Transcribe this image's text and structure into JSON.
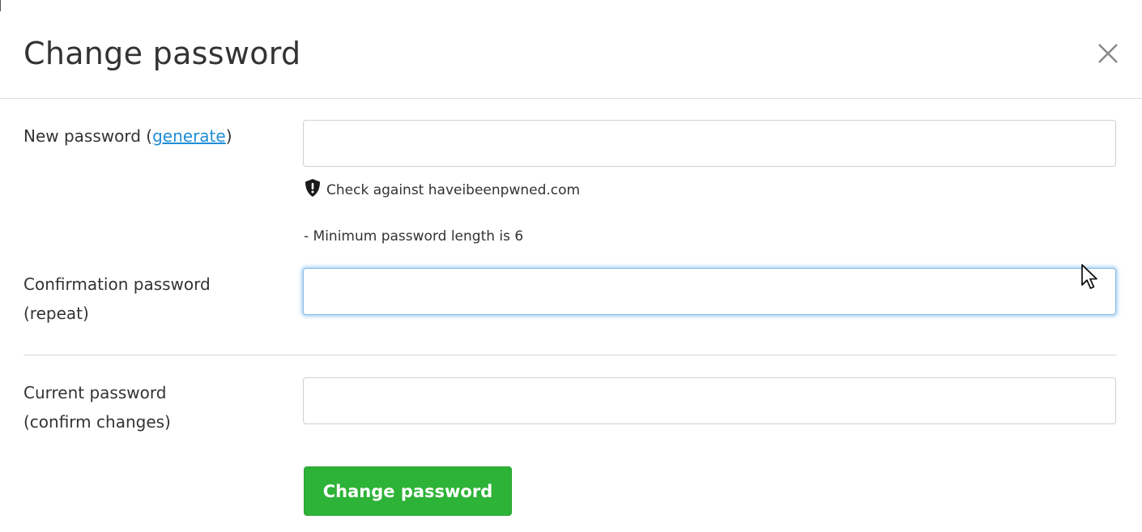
{
  "dialog": {
    "title": "Change password",
    "close_icon": "close-icon"
  },
  "new_password": {
    "label_prefix": "New password (",
    "generate_link": "generate",
    "label_suffix": ")",
    "value": "",
    "pwned_check": "Check against haveibeenpwned.com",
    "pwned_icon": "shield-exclamation-icon",
    "min_length_hint": "- Minimum password length is 6"
  },
  "confirm_password": {
    "label_line1": "Confirmation password",
    "label_line2": "(repeat)",
    "value": ""
  },
  "current_password": {
    "label_line1": "Current password",
    "label_line2": "(confirm changes)",
    "value": ""
  },
  "submit": {
    "label": "Change password",
    "color": "#2db337"
  },
  "colors": {
    "link": "#1f8dd6",
    "focus_glow": "#66afe9"
  }
}
